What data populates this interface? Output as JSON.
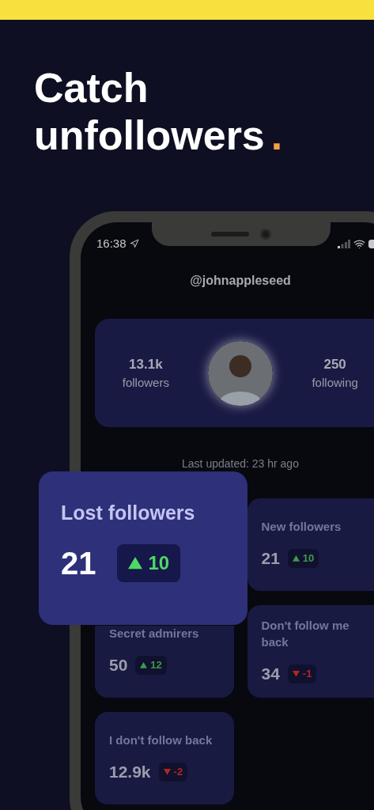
{
  "headline": {
    "text": "Catch unfollowers",
    "mark": "."
  },
  "status_bar": {
    "time": "16:38"
  },
  "username": "@johnappleseed",
  "profile": {
    "followers": {
      "value": "13.1k",
      "label": "followers"
    },
    "following": {
      "value": "250",
      "label": "following"
    }
  },
  "last_updated": "Last updated: 23 hr ago",
  "featured_card": {
    "title": "Lost followers",
    "value": "21",
    "delta": {
      "rising": true,
      "text": "10"
    }
  },
  "tiles": [
    {
      "title": "New followers",
      "value": "21",
      "delta": {
        "rising": true,
        "text": "10"
      }
    },
    {
      "title": "Secret admirers",
      "value": "50",
      "delta": {
        "rising": true,
        "text": "12"
      }
    },
    {
      "title": "Don't follow me back",
      "value": "34",
      "delta": {
        "rising": false,
        "text": "-1"
      }
    },
    {
      "title": "I don't follow back",
      "value": "12.9k",
      "delta": {
        "rising": false,
        "text": "-2"
      }
    }
  ]
}
